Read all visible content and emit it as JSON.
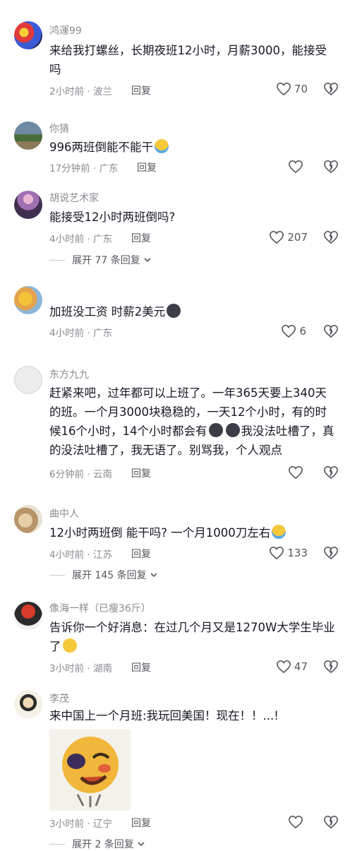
{
  "comments": [
    {
      "username": "鸿運99",
      "text": "来给我打螺丝，长期夜班12小时，月薪3000，能接受吗",
      "time": "2小时前",
      "location": "波兰",
      "reply": "回复",
      "likes": "70"
    },
    {
      "username": "你猜",
      "text": "996两班倒能不能干",
      "time": "17分钟前",
      "location": "广东",
      "reply": "回复",
      "likes": ""
    },
    {
      "username": "胡说艺术家",
      "text": "能接受12小时两班倒吗?",
      "time": "4小时前",
      "location": "广东",
      "reply": "回复",
      "likes": "207",
      "expand": "展开 77 条回复"
    },
    {
      "username": "",
      "text": "加班没工资  时薪2美元",
      "time": "4小时前",
      "location": "广东",
      "reply": "",
      "likes": "6"
    },
    {
      "username": "东方九九",
      "text": "赶紧来吧，过年都可以上班了。一年365天要上340天的班。一个月3000块稳稳的，一天12个小时，有的时候16个小时，14个小时都会有",
      "text2": "我没法吐槽了，真的没法吐槽了，我无语了。别骂我，个人观点",
      "time": "6分钟前",
      "location": "云南",
      "reply": "回复",
      "likes": ""
    },
    {
      "username": "曲中人",
      "text": "12小时两班倒 能干吗?  一个月1000刀左右",
      "time": "4小时前",
      "location": "江苏",
      "reply": "回复",
      "likes": "133",
      "expand": "展开 145 条回复"
    },
    {
      "username": "像海一样（已瘦36斤）",
      "text": "告诉你一个好消息：在过几个月又是1270W大学生毕业了",
      "time": "3小时前",
      "location": "湖南",
      "reply": "回复",
      "likes": "47"
    },
    {
      "username": "李茂",
      "text": "来中国上一个月班:我玩回美国！现在！！...!",
      "time": "3小时前",
      "location": "辽宁",
      "reply": "回复",
      "likes": "",
      "expand": "展开 2 条回复"
    }
  ],
  "colors": {
    "text": "#161823",
    "meta": "#8a8b91",
    "icon": "#55565c"
  }
}
